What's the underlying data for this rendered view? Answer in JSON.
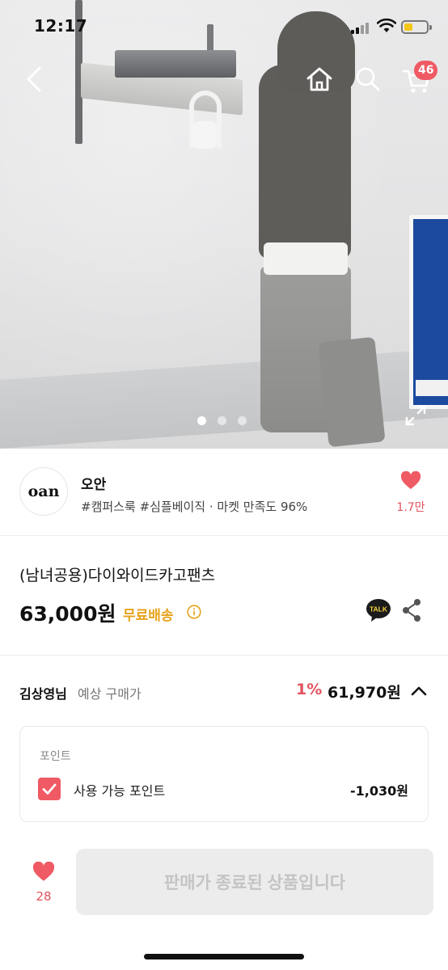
{
  "status_bar": {
    "time": "12:17"
  },
  "header": {
    "cart_count": "46"
  },
  "gallery": {
    "total_images": 3,
    "active_index": 0
  },
  "seller": {
    "logo_text": "oan",
    "name": "오안",
    "meta": "#캠퍼스룩 #심플베이직 · 마켓 만족도 96%",
    "likes": "1.7만"
  },
  "product": {
    "name": "(남녀공용)다이와이드카고팬츠",
    "price": "63,000원",
    "shipping": "무료배송",
    "talk_label": "TALK"
  },
  "estimate": {
    "user": "김상영님",
    "label": "예상 구매가",
    "discount": "1%",
    "price": "61,970원"
  },
  "points": {
    "title": "포인트",
    "label": "사용 가능 포인트",
    "value": "-1,030원",
    "checked": true
  },
  "bottom": {
    "likes": "28",
    "button_label": "판매가 종료된 상품입니다"
  },
  "colors": {
    "accent_red": "#ef5a64",
    "shipping_orange": "#e7a21b",
    "disabled_bg": "#ececec"
  }
}
